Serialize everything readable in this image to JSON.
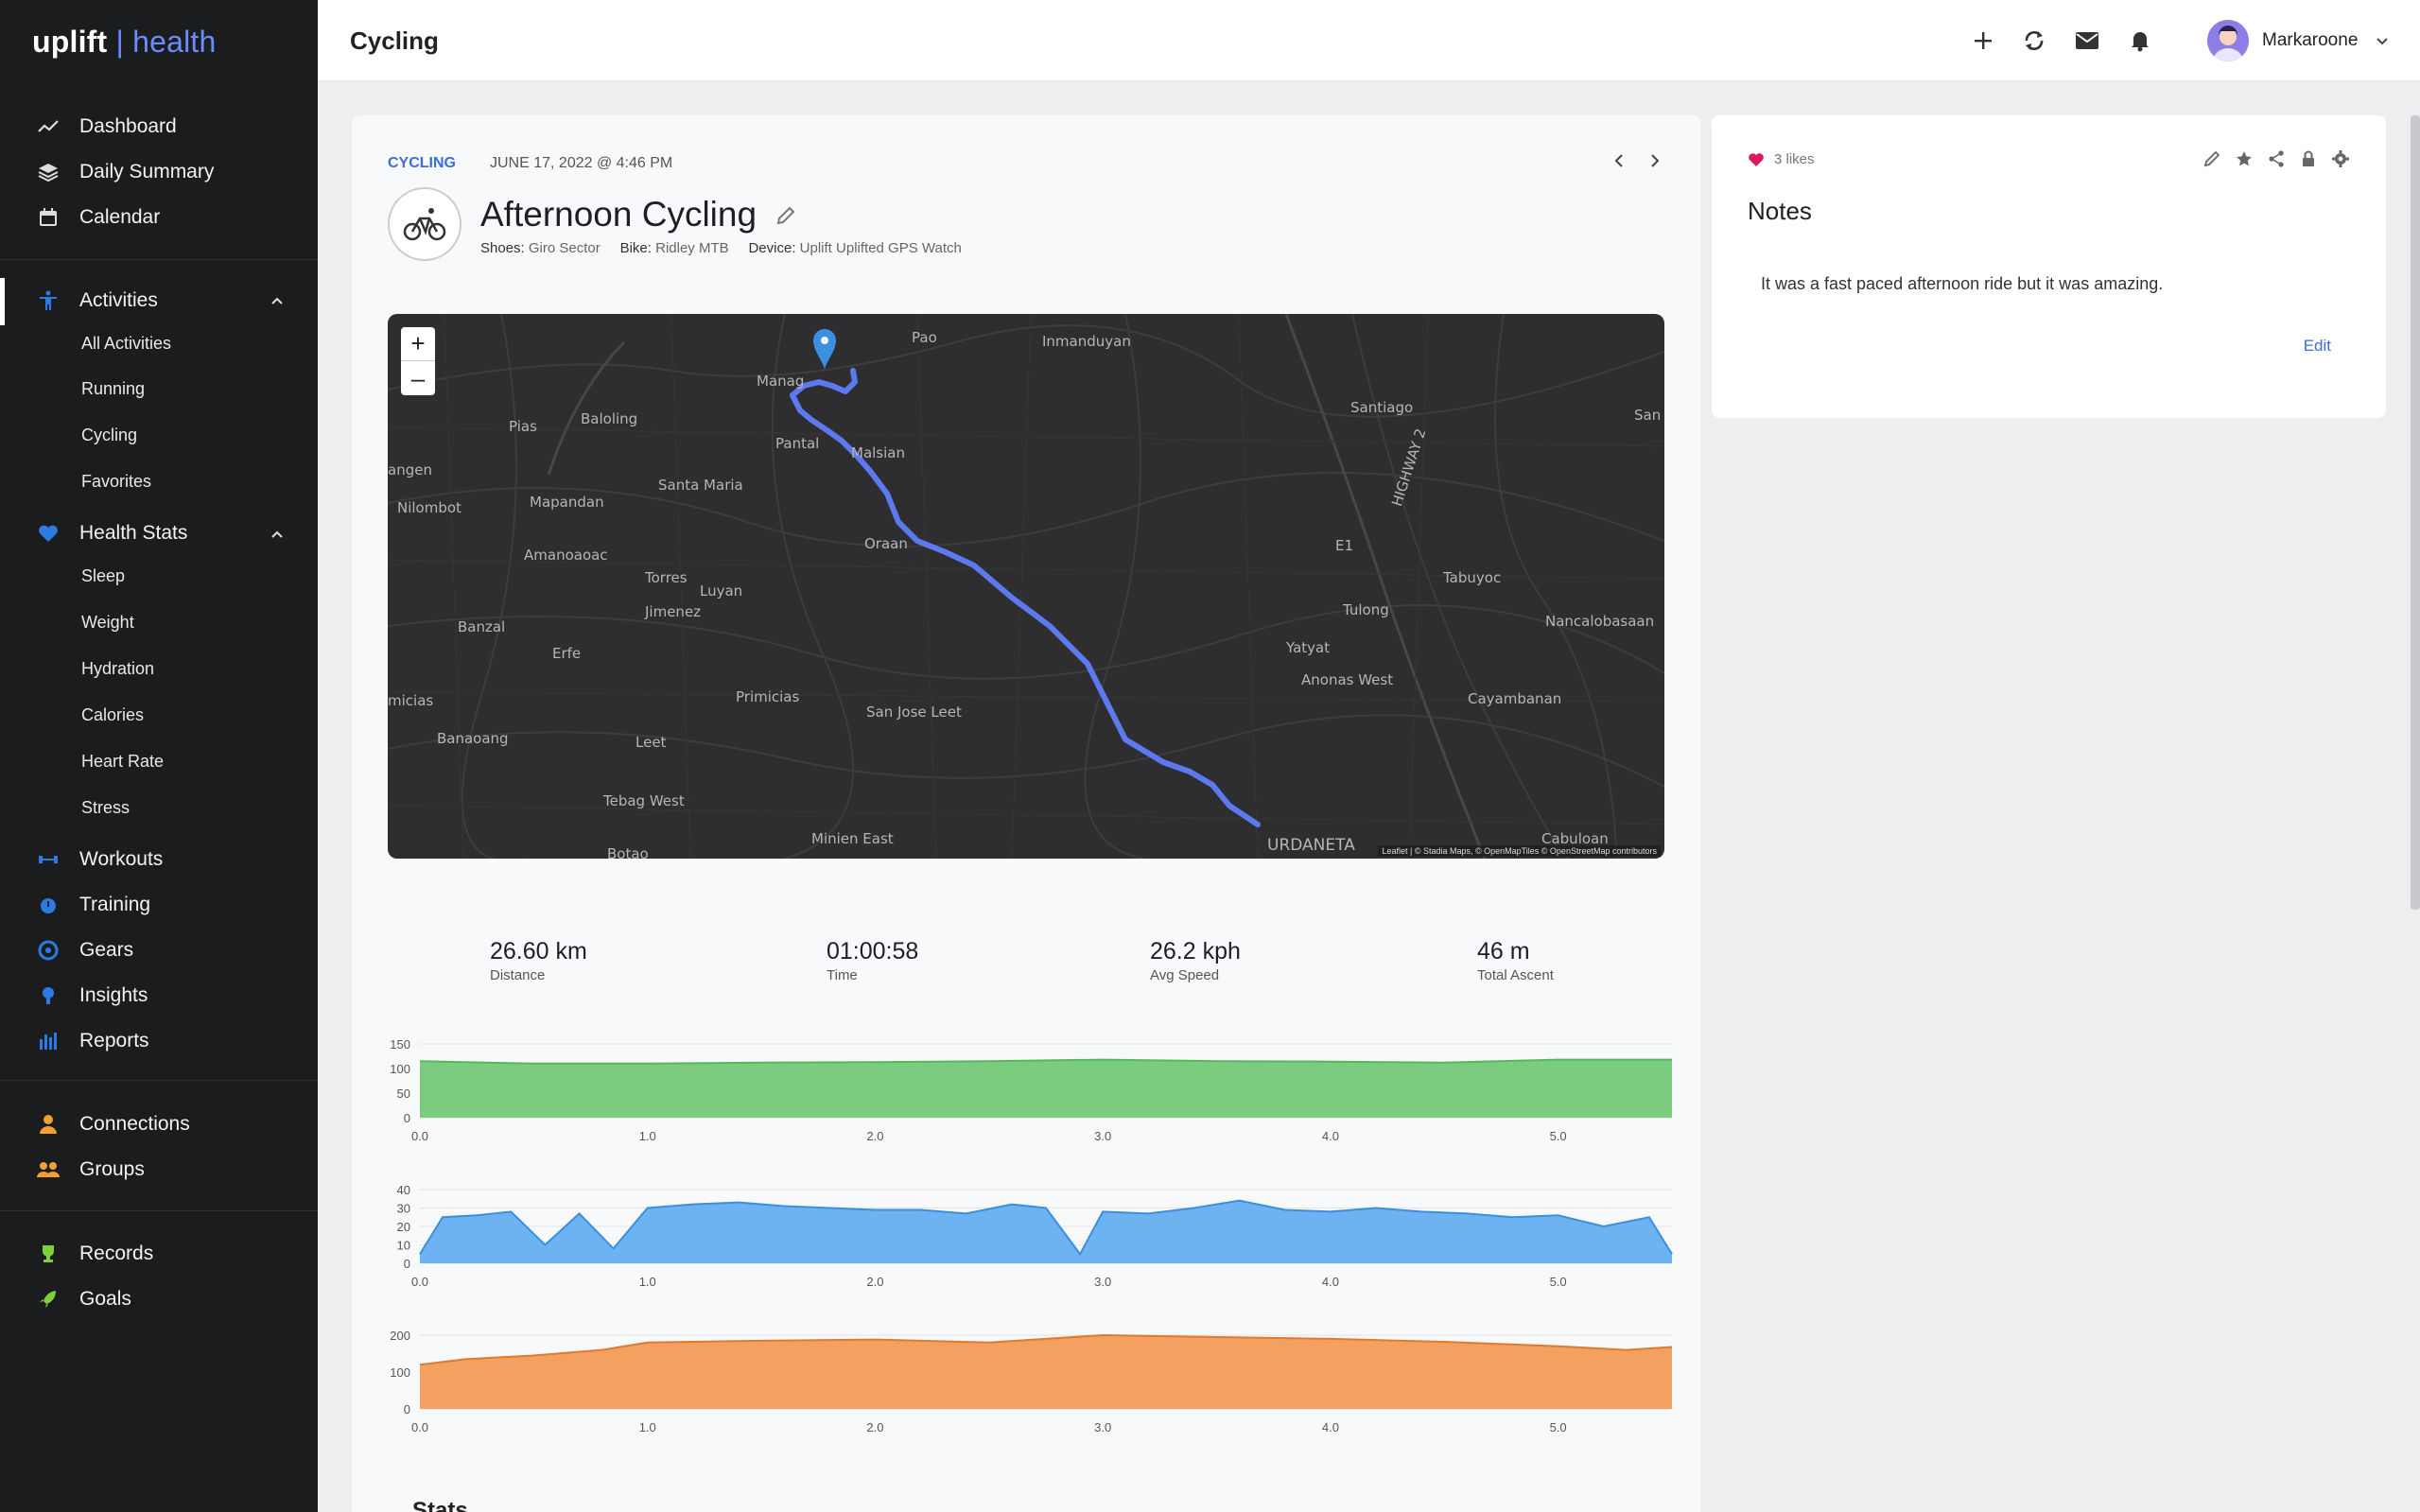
{
  "app": {
    "logo_primary": "uplift",
    "logo_secondary": "| health"
  },
  "sidebar": {
    "items": [
      {
        "label": "Dashboard",
        "icon": "trend-icon"
      },
      {
        "label": "Daily Summary",
        "icon": "layers-icon"
      },
      {
        "label": "Calendar",
        "icon": "calendar-icon"
      }
    ],
    "activities": {
      "label": "Activities",
      "icon": "person-icon",
      "sub": [
        "All Activities",
        "Running",
        "Cycling",
        "Favorites"
      ]
    },
    "health": {
      "label": "Health Stats",
      "icon": "heart-icon",
      "sub": [
        "Sleep",
        "Weight",
        "Hydration",
        "Calories",
        "Heart Rate",
        "Stress"
      ]
    },
    "more": [
      {
        "label": "Workouts",
        "icon": "dumbbell-icon"
      },
      {
        "label": "Training",
        "icon": "stopwatch-icon"
      },
      {
        "label": "Gears",
        "icon": "gear-wheel-icon"
      },
      {
        "label": "Insights",
        "icon": "bulb-icon"
      },
      {
        "label": "Reports",
        "icon": "bar-chart-icon"
      }
    ],
    "social": [
      {
        "label": "Connections",
        "icon": "person-icon"
      },
      {
        "label": "Groups",
        "icon": "group-icon"
      }
    ],
    "goals": [
      {
        "label": "Records",
        "icon": "trophy-icon"
      },
      {
        "label": "Goals",
        "icon": "rocket-icon"
      }
    ],
    "accent": "#2c7be5"
  },
  "header": {
    "title": "Cycling",
    "user_name": "Markaroone"
  },
  "activity": {
    "category": "CYCLING",
    "date": "JUNE 17, 2022 @ 4:46 PM",
    "title": "Afternoon Cycling",
    "shoes_label": "Shoes:",
    "shoes": "Giro Sector",
    "bike_label": "Bike:",
    "bike": "Ridley MTB",
    "device_label": "Device:",
    "device": "Uplift Uplifted GPS Watch"
  },
  "map": {
    "zoom_in": "+",
    "zoom_out": "–",
    "attribution": "Leaflet | © Stadia Maps, © OpenMapTiles © OpenStreetMap contributors",
    "labels": [
      "Pao",
      "Inmanduyan",
      "Manag",
      "Baloling",
      "Pias",
      "Pantal",
      "Malsian",
      "Santiago",
      "San",
      "angen",
      "Nilombot",
      "Mapandan",
      "Santa Maria",
      "HIGHWAY 2",
      "E1",
      "Oraan",
      "Amanoaoac",
      "Torres",
      "Luyan",
      "Tabuyoc",
      "Tulong",
      "Jimenez",
      "Banzal",
      "Nancalobasaan",
      "Yatyat",
      "Erfe",
      "Anonas West",
      "micias",
      "Primicias",
      "Cayambanan",
      "San Jose Leet",
      "Banaoang",
      "Leet",
      "Tebag West",
      "Minien East",
      "URDANETA",
      "Cabuloan",
      "Botao"
    ]
  },
  "stats": [
    {
      "value": "26.60 km",
      "label": "Distance"
    },
    {
      "value": "01:00:58",
      "label": "Time"
    },
    {
      "value": "26.2 kph",
      "label": "Avg Speed"
    },
    {
      "value": "46 m",
      "label": "Total Ascent"
    }
  ],
  "chart_data": [
    {
      "type": "area",
      "color": "#7ccc80",
      "stroke": "#55b85a",
      "ylim": [
        0,
        150
      ],
      "yticks": [
        0,
        50,
        100,
        150
      ],
      "xticks": [
        0.0,
        1.0,
        2.0,
        3.0,
        4.0,
        5.0
      ],
      "xtick_labels": [
        "0.0",
        "1.0",
        "2.0",
        "3.0",
        "4.0",
        "5.0"
      ],
      "xlim": [
        0,
        5.5
      ],
      "x": [
        0,
        0.5,
        1.0,
        1.5,
        2.0,
        2.5,
        3.0,
        3.5,
        4.0,
        4.5,
        5.0,
        5.5
      ],
      "values": [
        115,
        110,
        110,
        112,
        113,
        115,
        118,
        115,
        114,
        112,
        118,
        118
      ]
    },
    {
      "type": "area",
      "color": "#6db3f2",
      "stroke": "#3a8fe0",
      "ylim": [
        0,
        40
      ],
      "yticks": [
        0,
        10,
        20,
        30,
        40
      ],
      "xticks": [
        0.0,
        1.0,
        2.0,
        3.0,
        4.0,
        5.0
      ],
      "xtick_labels": [
        "0.0",
        "1.0",
        "2.0",
        "3.0",
        "4.0",
        "5.0"
      ],
      "xlim": [
        0,
        5.5
      ],
      "x": [
        0,
        0.1,
        0.25,
        0.4,
        0.55,
        0.7,
        0.85,
        1.0,
        1.2,
        1.4,
        1.6,
        1.8,
        2.0,
        2.2,
        2.4,
        2.6,
        2.75,
        2.9,
        3.0,
        3.2,
        3.4,
        3.6,
        3.8,
        4.0,
        4.2,
        4.4,
        4.6,
        4.8,
        5.0,
        5.2,
        5.4,
        5.5
      ],
      "values": [
        5,
        25,
        26,
        28,
        10,
        27,
        8,
        30,
        32,
        33,
        31,
        30,
        29,
        29,
        27,
        32,
        30,
        5,
        28,
        27,
        30,
        34,
        29,
        28,
        30,
        28,
        27,
        25,
        26,
        20,
        25,
        5
      ]
    },
    {
      "type": "area",
      "color": "#f4a060",
      "stroke": "#e07a2e",
      "ylim": [
        0,
        200
      ],
      "yticks": [
        0,
        100,
        200
      ],
      "xticks": [
        0.0,
        1.0,
        2.0,
        3.0,
        4.0,
        5.0
      ],
      "xtick_labels": [
        "0.0",
        "1.0",
        "2.0",
        "3.0",
        "4.0",
        "5.0"
      ],
      "xlim": [
        0,
        5.5
      ],
      "x": [
        0,
        0.2,
        0.5,
        0.8,
        1.0,
        1.5,
        2.0,
        2.5,
        3.0,
        3.5,
        4.0,
        4.5,
        5.0,
        5.3,
        5.5
      ],
      "values": [
        120,
        135,
        145,
        160,
        180,
        185,
        188,
        180,
        200,
        195,
        190,
        182,
        170,
        160,
        168
      ]
    }
  ],
  "notes": {
    "likes": "3 likes",
    "title": "Notes",
    "text": "It was a fast paced afternoon ride but it was amazing.",
    "edit": "Edit"
  },
  "section": {
    "next_title": "Stats"
  }
}
